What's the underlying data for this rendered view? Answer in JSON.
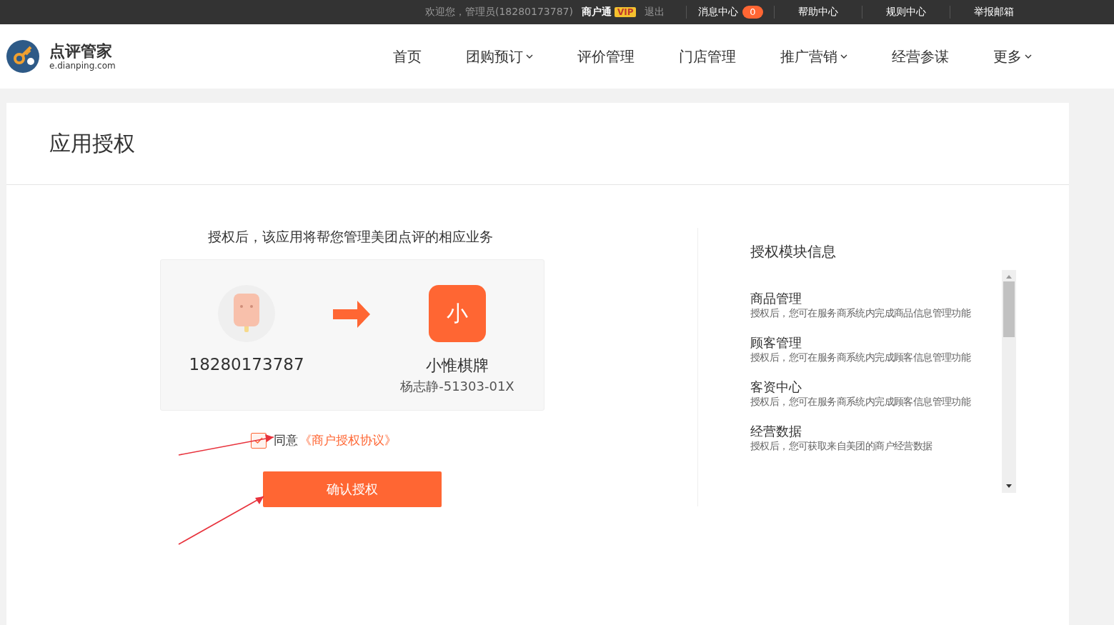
{
  "top_bar": {
    "welcome": "欢迎您，管理员(18280173787)",
    "account": "商户通",
    "badge": "VIP",
    "logout": "退出",
    "links": [
      {
        "label": "消息中心",
        "count": "0"
      },
      {
        "label": "帮助中心"
      },
      {
        "label": "规则中心"
      },
      {
        "label": "举报邮箱"
      }
    ]
  },
  "header": {
    "logo_title": "点评管家",
    "logo_domain": "e.dianping.com",
    "nav": [
      {
        "label": "首页",
        "has_dropdown": false
      },
      {
        "label": "团购预订",
        "has_dropdown": true
      },
      {
        "label": "评价管理",
        "has_dropdown": false
      },
      {
        "label": "门店管理",
        "has_dropdown": false
      },
      {
        "label": "推广营销",
        "has_dropdown": true
      },
      {
        "label": "经营参谋",
        "has_dropdown": false
      },
      {
        "label": "更多",
        "has_dropdown": true
      }
    ]
  },
  "page": {
    "title": "应用授权",
    "intro": "授权后，该应用将帮您管理美团点评的相应业务",
    "user": {
      "phone": "18280173787"
    },
    "app": {
      "icon_text": "小",
      "name": "小惟棋牌",
      "subtitle": "杨志静-51303-01X"
    },
    "agree": {
      "checked": true,
      "label": "同意",
      "link": "《商户授权协议》"
    },
    "confirm_button": "确认授权"
  },
  "modules": {
    "title": "授权模块信息",
    "items": [
      {
        "name": "商品管理",
        "description": "授权后，您可在服务商系统内完成商品信息管理功能"
      },
      {
        "name": "顾客管理",
        "description": "授权后，您可在服务商系统内完成顾客信息管理功能"
      },
      {
        "name": "客资中心",
        "description": "授权后，您可在服务商系统内完成顾客信息管理功能"
      },
      {
        "name": "经营数据",
        "description": "授权后，您可获取来自美团的商户经营数据"
      }
    ]
  }
}
